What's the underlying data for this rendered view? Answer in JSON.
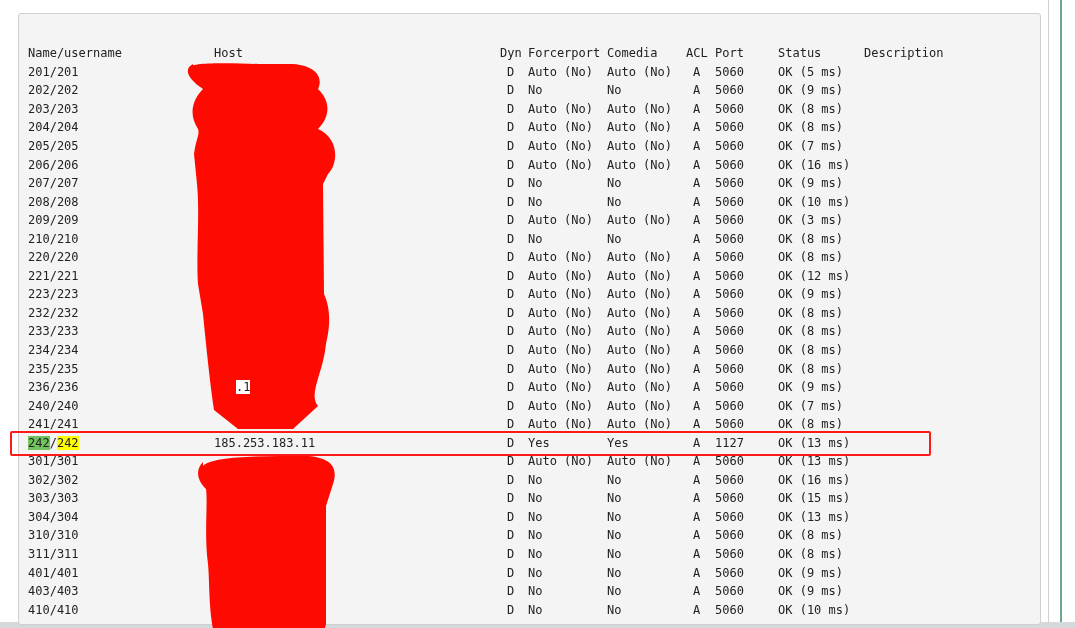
{
  "columns": [
    "Name/username",
    "Host",
    "Dyn",
    "Forcerport",
    "Comedia",
    "ACL",
    "Port",
    "Status",
    "Description"
  ],
  "rows": [
    {
      "name": "201/201",
      "dyn": "D",
      "forcerport": "Auto (No)",
      "comedia": "Auto (No)",
      "acl": "A",
      "port": "5060",
      "status": "OK (5 ms)",
      "outlined": false
    },
    {
      "name": "202/202",
      "dyn": "D",
      "forcerport": "No",
      "comedia": "No",
      "acl": "A",
      "port": "5060",
      "status": "OK (9 ms)",
      "outlined": false
    },
    {
      "name": "203/203",
      "dyn": "D",
      "forcerport": "Auto (No)",
      "comedia": "Auto (No)",
      "acl": "A",
      "port": "5060",
      "status": "OK (8 ms)",
      "outlined": false
    },
    {
      "name": "204/204",
      "dyn": "D",
      "forcerport": "Auto (No)",
      "comedia": "Auto (No)",
      "acl": "A",
      "port": "5060",
      "status": "OK (8 ms)",
      "outlined": false
    },
    {
      "name": "205/205",
      "dyn": "D",
      "forcerport": "Auto (No)",
      "comedia": "Auto (No)",
      "acl": "A",
      "port": "5060",
      "status": "OK (7 ms)",
      "outlined": false
    },
    {
      "name": "206/206",
      "dyn": "D",
      "forcerport": "Auto (No)",
      "comedia": "Auto (No)",
      "acl": "A",
      "port": "5060",
      "status": "OK (16 ms)",
      "outlined": false
    },
    {
      "name": "207/207",
      "dyn": "D",
      "forcerport": "No",
      "comedia": "No",
      "acl": "A",
      "port": "5060",
      "status": "OK (9 ms)",
      "outlined": false
    },
    {
      "name": "208/208",
      "dyn": "D",
      "forcerport": "No",
      "comedia": "No",
      "acl": "A",
      "port": "5060",
      "status": "OK (10 ms)",
      "outlined": false
    },
    {
      "name": "209/209",
      "dyn": "D",
      "forcerport": "Auto (No)",
      "comedia": "Auto (No)",
      "acl": "A",
      "port": "5060",
      "status": "OK (3 ms)",
      "outlined": false
    },
    {
      "name": "210/210",
      "dyn": "D",
      "forcerport": "No",
      "comedia": "No",
      "acl": "A",
      "port": "5060",
      "status": "OK (8 ms)",
      "outlined": false
    },
    {
      "name": "220/220",
      "dyn": "D",
      "forcerport": "Auto (No)",
      "comedia": "Auto (No)",
      "acl": "A",
      "port": "5060",
      "status": "OK (8 ms)",
      "outlined": false
    },
    {
      "name": "221/221",
      "dyn": "D",
      "forcerport": "Auto (No)",
      "comedia": "Auto (No)",
      "acl": "A",
      "port": "5060",
      "status": "OK (12 ms)",
      "outlined": false
    },
    {
      "name": "223/223",
      "dyn": "D",
      "forcerport": "Auto (No)",
      "comedia": "Auto (No)",
      "acl": "A",
      "port": "5060",
      "status": "OK (9 ms)",
      "outlined": false
    },
    {
      "name": "232/232",
      "dyn": "D",
      "forcerport": "Auto (No)",
      "comedia": "Auto (No)",
      "acl": "A",
      "port": "5060",
      "status": "OK (8 ms)",
      "outlined": false
    },
    {
      "name": "233/233",
      "dyn": "D",
      "forcerport": "Auto (No)",
      "comedia": "Auto (No)",
      "acl": "A",
      "port": "5060",
      "status": "OK (8 ms)",
      "outlined": false
    },
    {
      "name": "234/234",
      "dyn": "D",
      "forcerport": "Auto (No)",
      "comedia": "Auto (No)",
      "acl": "A",
      "port": "5060",
      "status": "OK (8 ms)",
      "outlined": false
    },
    {
      "name": "235/235",
      "dyn": "D",
      "forcerport": "Auto (No)",
      "comedia": "Auto (No)",
      "acl": "A",
      "port": "5060",
      "status": "OK (8 ms)",
      "outlined": false
    },
    {
      "name": "236/236",
      "host": ".1",
      "dyn": "D",
      "forcerport": "Auto (No)",
      "comedia": "Auto (No)",
      "acl": "A",
      "port": "5060",
      "status": "OK (9 ms)",
      "outlined": false
    },
    {
      "name": "240/240",
      "dyn": "D",
      "forcerport": "Auto (No)",
      "comedia": "Auto (No)",
      "acl": "A",
      "port": "5060",
      "status": "OK (7 ms)",
      "outlined": false
    },
    {
      "name": "241/241",
      "dyn": "D",
      "forcerport": "Auto (No)",
      "comedia": "Auto (No)",
      "acl": "A",
      "port": "5060",
      "status": "OK (8 ms)",
      "outlined": false
    },
    {
      "name_parts": [
        {
          "text": "242",
          "color": "#70c35f"
        },
        {
          "text": "/"
        },
        {
          "text": "242",
          "color": "#ffff00"
        }
      ],
      "host": "185.253.183.11",
      "dyn": "D",
      "forcerport": "Yes",
      "comedia": "Yes",
      "acl": "A",
      "port": "1127",
      "status": "OK (13 ms)",
      "outlined": true
    },
    {
      "name": "301/301",
      "dyn": "D",
      "forcerport": "Auto (No)",
      "comedia": "Auto (No)",
      "acl": "A",
      "port": "5060",
      "status": "OK (13 ms)",
      "outlined": false
    },
    {
      "name": "302/302",
      "dyn": "D",
      "forcerport": "No",
      "comedia": "No",
      "acl": "A",
      "port": "5060",
      "status": "OK (16 ms)",
      "outlined": false
    },
    {
      "name": "303/303",
      "dyn": "D",
      "forcerport": "No",
      "comedia": "No",
      "acl": "A",
      "port": "5060",
      "status": "OK (15 ms)",
      "outlined": false
    },
    {
      "name": "304/304",
      "dyn": "D",
      "forcerport": "No",
      "comedia": "No",
      "acl": "A",
      "port": "5060",
      "status": "OK (13 ms)",
      "outlined": false
    },
    {
      "name": "310/310",
      "dyn": "D",
      "forcerport": "No",
      "comedia": "No",
      "acl": "A",
      "port": "5060",
      "status": "OK (8 ms)",
      "outlined": false
    },
    {
      "name": "311/311",
      "dyn": "D",
      "forcerport": "No",
      "comedia": "No",
      "acl": "A",
      "port": "5060",
      "status": "OK (8 ms)",
      "outlined": false
    },
    {
      "name": "401/401",
      "dyn": "D",
      "forcerport": "No",
      "comedia": "No",
      "acl": "A",
      "port": "5060",
      "status": "OK (9 ms)",
      "outlined": false
    },
    {
      "name": "403/403",
      "dyn": "D",
      "forcerport": "No",
      "comedia": "No",
      "acl": "A",
      "port": "5060",
      "status": "OK (9 ms)",
      "outlined": false
    },
    {
      "name": "410/410",
      "dyn": "D",
      "forcerport": "No",
      "comedia": "No",
      "acl": "A",
      "port": "5060",
      "status": "OK (10 ms)",
      "outlined": false
    }
  ]
}
